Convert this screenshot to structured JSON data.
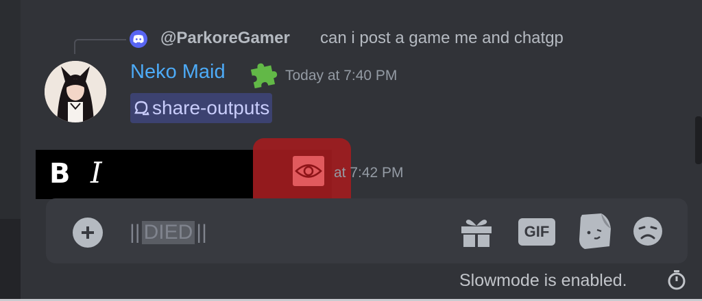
{
  "reply": {
    "username": "@ParkoreGamer",
    "text": "can i post a game me and chatgp"
  },
  "message": {
    "author": "Neko Maid",
    "timestamp": "Today at 7:40 PM",
    "channel_mention": "share-outputs"
  },
  "formatting_toolbar": {
    "bold_label": "B",
    "italic_label": "I"
  },
  "next_message": {
    "timestamp_partial": "at 7:42 PM"
  },
  "composer": {
    "open_bars": "||",
    "spoiler_text": "DIED",
    "close_bars": "||",
    "gif_label": "GIF"
  },
  "footer": {
    "slowmode_text": "Slowmode is enabled."
  },
  "colors": {
    "background": "#313338",
    "author_name": "#4dabf7",
    "mention_bg": "#3c4270",
    "spoiler_highlight": "#9f1c20",
    "discord_blurple": "#5865f2"
  },
  "icons": [
    "discord-logo-icon",
    "puzzle-piece-icon",
    "thread-icon",
    "eye-icon",
    "plus-icon",
    "gift-icon",
    "sticker-icon",
    "emoji-icon",
    "timer-icon"
  ]
}
